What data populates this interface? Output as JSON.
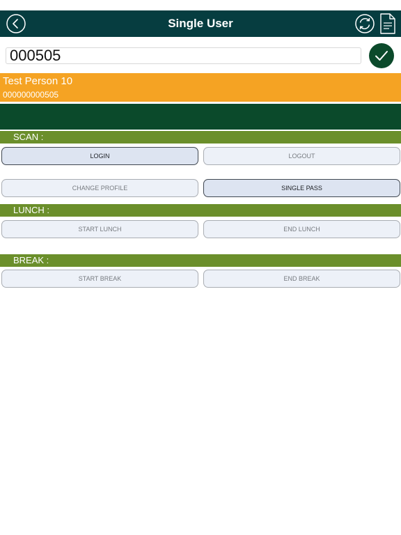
{
  "header": {
    "title": "Single User",
    "back_icon": "chevron-left-circle-icon",
    "refresh_icon": "refresh-icon",
    "document_icon": "document-icon"
  },
  "search": {
    "value": "000505",
    "confirm_icon": "checkmark-icon"
  },
  "user": {
    "name": "Test Person 10",
    "id": "000000000505"
  },
  "sections": {
    "scan": {
      "label": "SCAN :",
      "login": "LOGIN",
      "logout": "LOGOUT",
      "change_profile": "CHANGE PROFILE",
      "single_pass": "SINGLE PASS"
    },
    "lunch": {
      "label": "LUNCH :",
      "start": "START LUNCH",
      "end": "END LUNCH"
    },
    "break": {
      "label": "BREAK :",
      "start": "START BREAK",
      "end": "END BREAK"
    }
  },
  "colors": {
    "navbar": "#063d40",
    "user_bar": "#f5a323",
    "dark_band": "#0b4a2b",
    "section_header": "#6b8f2b",
    "button_fill": "#edf1f8"
  }
}
